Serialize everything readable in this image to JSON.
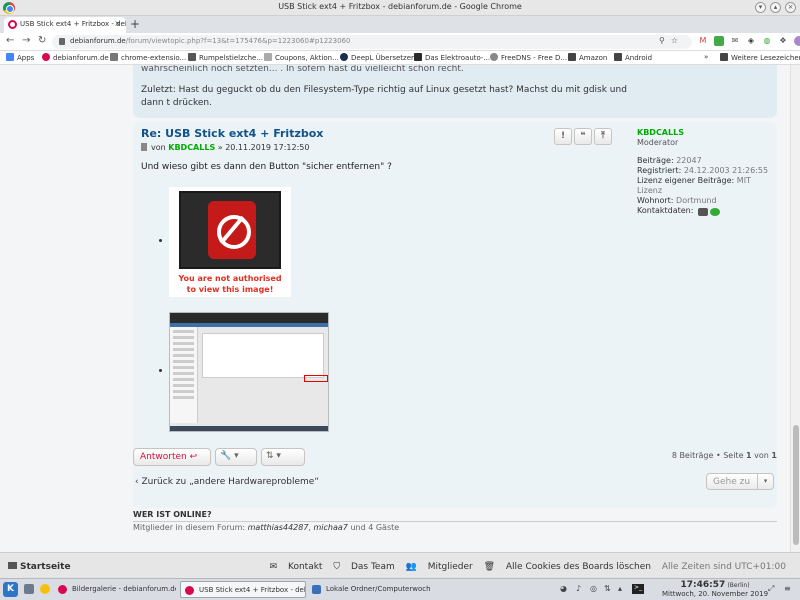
{
  "window": {
    "title": "USB Stick ext4 + Fritzbox - debianforum.de - Google Chrome"
  },
  "tab": {
    "title": "USB Stick ext4 + Fritzbox - deb",
    "close": "×",
    "new": "+"
  },
  "address": {
    "domain": "debianforum.de",
    "path": "/forum/viewtopic.php?f=13&t=175476&p=1223060#p1223060"
  },
  "bookmarks": {
    "items": [
      "Apps",
      "debianforum.de",
      "chrome-extensio...",
      "Rumpelstielzche...",
      "Coupons, Aktion...",
      "DeepL Übersetzer",
      "Das Elektroauto-...",
      "FreeDNS - Free D...",
      "Amazon",
      "Android"
    ],
    "more": "»",
    "other": "Weitere Lesezeichen"
  },
  "prev_post": {
    "line1": "wahrscheinlich noch setzten... . In sofern hast du vielleicht schon recht.",
    "line2": "Zuletzt: Hast du geguckt ob du den Filesystem-Type richtig auf Linux gesetzt hast? Machst du mit gdisk und",
    "line3": "dann t drücken."
  },
  "post": {
    "title": "Re: USB Stick ext4 + Fritzbox",
    "by": "von",
    "author": "KBDCALLS",
    "date": "» 20.11.2019 17:12:50",
    "text": "Und wieso gibt es dann den Button \"sicher entfernen\" ?",
    "buttons": {
      "report": "!",
      "quote": "❝",
      "top": "⤒"
    },
    "image_warning_1": "You are not authorised",
    "image_warning_2": "to view this image!"
  },
  "profile": {
    "username": "KBDCALLS",
    "rank": "Moderator",
    "posts_label": "Beiträge:",
    "posts": "22047",
    "registered_label": "Registriert:",
    "registered": "24.12.2003 21:26:55",
    "license_label": "Lizenz eigener Beiträge:",
    "license": "MIT Lizenz",
    "location_label": "Wohnort:",
    "location": "Dortmund",
    "contact_label": "Kontaktdaten:"
  },
  "actions": {
    "reply": "Antworten",
    "reply_icon": "↩",
    "tools_icon": "🔧",
    "sort_icon": "⇅",
    "dropdown": "▾",
    "pagination_pre": "8 Beiträge • Seite",
    "page": "1",
    "of": "von",
    "total": "1"
  },
  "back_link": "Zurück zu „andere Hardwareprobleme“",
  "back_icon": "‹",
  "jump": {
    "label": "Gehe zu",
    "icon": "▾"
  },
  "online": {
    "heading": "WER IST ONLINE?",
    "prefix": "Mitglieder in diesem Forum:",
    "user1": "matthias44287",
    "sep": ",",
    "user2": "michaa7",
    "suffix": "und 4 Gäste"
  },
  "footer": {
    "home": "Startseite",
    "contact": "Kontakt",
    "team": "Das Team",
    "members": "Mitglieder",
    "cookies": "Alle Cookies des Boards löschen",
    "timezone": "Alle Zeiten sind UTC+01:00"
  },
  "taskbar": {
    "task1": "Bildergalerie - debianforum.de - ...",
    "task2": "USB Stick ext4 + Fritzbox - debianf...",
    "task3": "Lokale Ordner/Computerwoche ...",
    "time": "17:46:57",
    "city": "(Berlin)",
    "date": "Mittwoch, 20. November 2019"
  },
  "colors": {
    "accent": "#d31141",
    "link": "#105289",
    "moderator": "#00aa00",
    "post_bg": "#ecf3f7"
  }
}
